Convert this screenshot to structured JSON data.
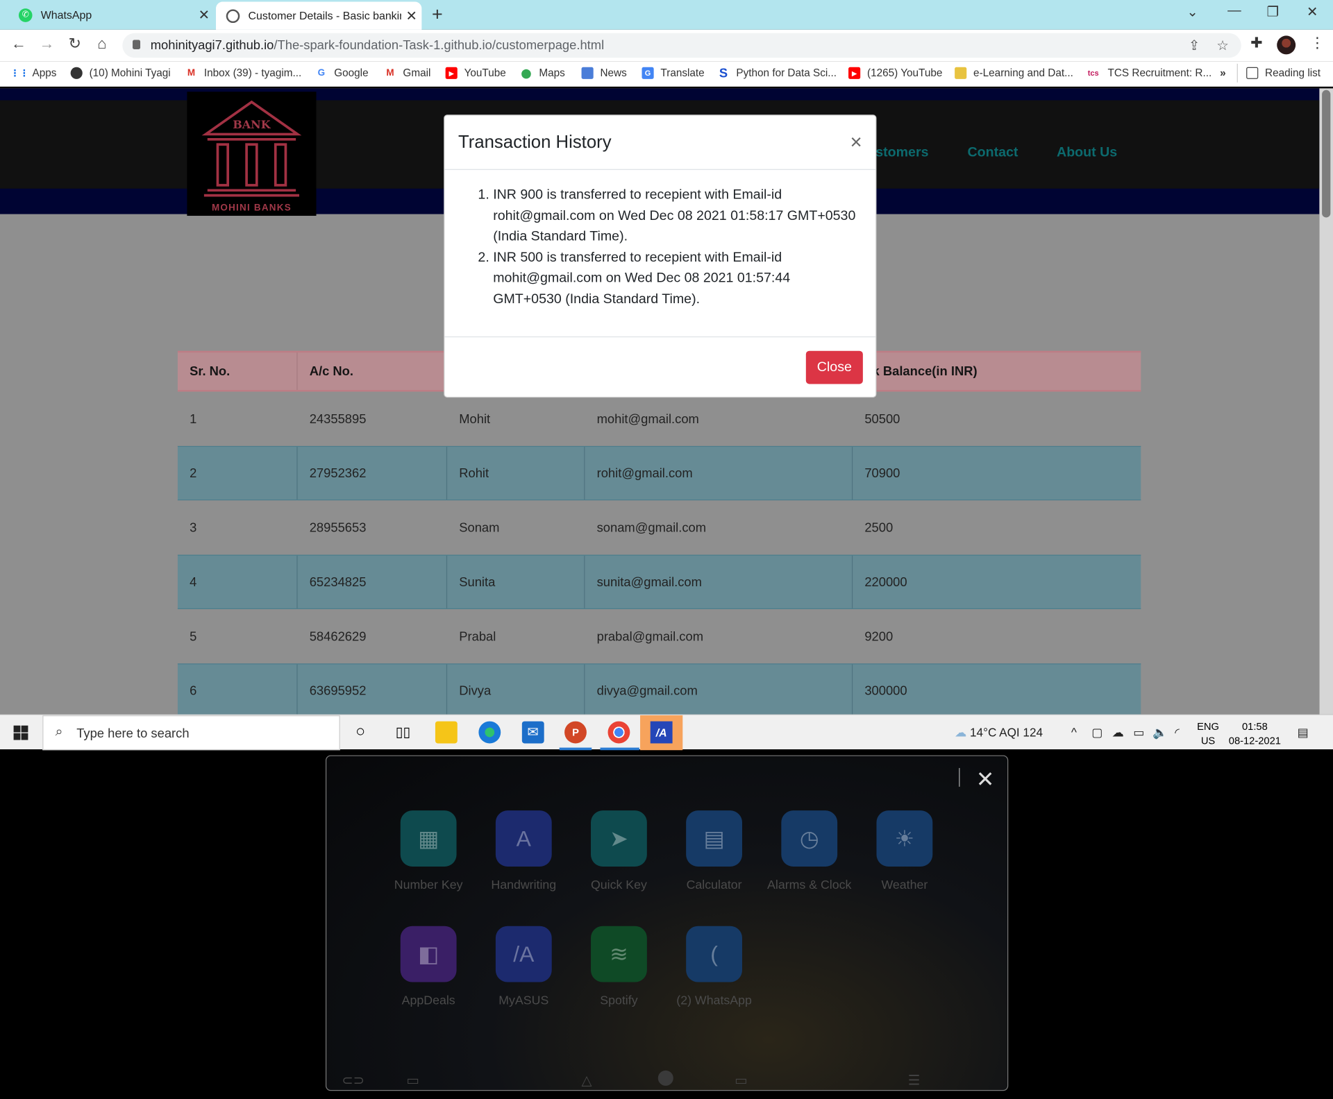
{
  "browser": {
    "tabs": [
      {
        "label": "WhatsApp",
        "active": false
      },
      {
        "label": "Customer Details - Basic banking",
        "active": true
      }
    ],
    "url_host": "mohinityagi7.github.io",
    "url_path": "/The-spark-foundation-Task-1.github.io/customerpage.html",
    "bookmarks": [
      {
        "label": "Apps",
        "icon": "apps-grid-icon"
      },
      {
        "label": "(10) Mohini Tyagi",
        "icon": "globe-icon"
      },
      {
        "label": "Inbox (39) - tyagim...",
        "icon": "gmail-icon"
      },
      {
        "label": "Google",
        "icon": "google-icon"
      },
      {
        "label": "Gmail",
        "icon": "gmail-icon"
      },
      {
        "label": "YouTube",
        "icon": "youtube-icon"
      },
      {
        "label": "Maps",
        "icon": "maps-icon"
      },
      {
        "label": "News",
        "icon": "news-icon"
      },
      {
        "label": "Translate",
        "icon": "translate-icon"
      },
      {
        "label": "Python for Data Sci...",
        "icon": "s-logo-icon"
      },
      {
        "label": "(1265) YouTube",
        "icon": "youtube-icon"
      },
      {
        "label": "e-Learning and Dat...",
        "icon": "elearning-icon"
      },
      {
        "label": "TCS Recruitment: R...",
        "icon": "tcs-icon"
      }
    ],
    "overflow_label": "»",
    "reading_list": "Reading list"
  },
  "site": {
    "logo_top": "BANK",
    "logo_bottom": "MOHINI BANKS",
    "nav": [
      "stomers",
      "Contact",
      "About Us"
    ]
  },
  "table": {
    "headers": [
      "Sr. No.",
      "A/c No.",
      "",
      "",
      "nk Balance(in INR)"
    ],
    "rows": [
      [
        "1",
        "24355895",
        "Mohit",
        "mohit@gmail.com",
        "50500"
      ],
      [
        "2",
        "27952362",
        "Rohit",
        "rohit@gmail.com",
        "70900"
      ],
      [
        "3",
        "28955653",
        "Sonam",
        "sonam@gmail.com",
        "2500"
      ],
      [
        "4",
        "65234825",
        "Sunita",
        "sunita@gmail.com",
        "220000"
      ],
      [
        "5",
        "58462629",
        "Prabal",
        "prabal@gmail.com",
        "9200"
      ],
      [
        "6",
        "63695952",
        "Divya",
        "divya@gmail.com",
        "300000"
      ]
    ]
  },
  "modal": {
    "title": "Transaction History",
    "close_x": "×",
    "items": [
      "INR 900 is transferred to recepient with Email-id rohit@gmail.com on Wed Dec 08 2021 01:58:17 GMT+0530 (India Standard Time).",
      "INR 500 is transferred to recepient with Email-id mohit@gmail.com on Wed Dec 08 2021 01:57:44 GMT+0530 (India Standard Time)."
    ],
    "close_button": "Close"
  },
  "taskbar": {
    "search_placeholder": "Type here to search",
    "weather": "14°C  AQI 124",
    "lang_top": "ENG",
    "lang_bottom": "US",
    "time": "01:58",
    "date": "08-12-2021"
  },
  "overlay": {
    "apps": [
      {
        "label": "Number Key",
        "icon": "number-key-icon",
        "color": "#0e4a4e"
      },
      {
        "label": "Handwriting",
        "icon": "handwriting-icon",
        "color": "#1c2a6e"
      },
      {
        "label": "Quick Key",
        "icon": "quick-key-icon",
        "color": "#0e4a4e"
      },
      {
        "label": "Calculator",
        "icon": "calculator-icon",
        "color": "#163a66"
      },
      {
        "label": "Alarms & Clock",
        "icon": "alarm-clock-icon",
        "color": "#163a66"
      },
      {
        "label": "Weather",
        "icon": "weather-icon",
        "color": "#163a66"
      },
      {
        "label": "AppDeals",
        "icon": "app-deals-icon",
        "color": "#3a1f66"
      },
      {
        "label": "MyASUS",
        "icon": "myasus-icon",
        "color": "#1c2a6e"
      },
      {
        "label": "Spotify",
        "icon": "spotify-icon",
        "color": "#0f4a26"
      },
      {
        "label": "(2) WhatsApp",
        "icon": "whatsapp-icon",
        "color": "#163a66"
      }
    ]
  }
}
